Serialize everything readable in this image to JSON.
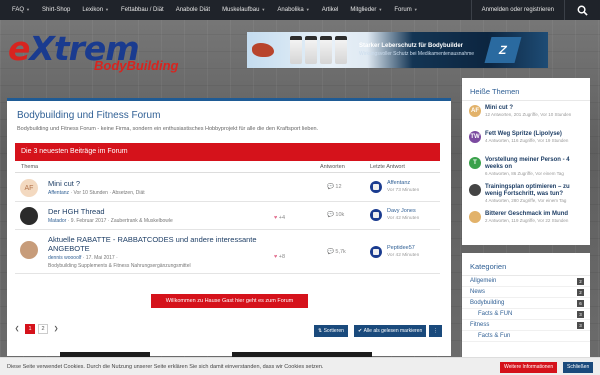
{
  "nav": {
    "items": [
      "FAQ",
      "Shirt-Shop",
      "Lexikon",
      "Fettabbau / Diät",
      "Anabole Diät",
      "Muskelaufbau",
      "Anabolika",
      "Artikel",
      "Mitglieder",
      "Forum"
    ],
    "login": "Anmelden oder registrieren"
  },
  "logo": {
    "ext_e": "e",
    "ext_rest": "Xtrem",
    "sub": "BodyBuilding"
  },
  "banner": {
    "line1": "Starker Leberschutz für Bodybuilder",
    "line2": "Wirkungsvoller Schutz bei Medikamentenausnahme"
  },
  "main": {
    "title": "Bodybuilding und Fitness Forum",
    "desc": "Bodybuilding und Fitness Forum - keine Firma, sondern ein enthusiastisches Hobbyprojekt für alle die den Kraftsport lieben.",
    "latest": "Die 3 neuesten Beiträge im Forum",
    "col_thema": "Thema",
    "col_antworten": "Antworten",
    "col_letzte": "Letzte Antwort",
    "rows": [
      {
        "avatar": "AF",
        "title": "Mini cut ?",
        "user": "Affentanz",
        "meta": "· Vor 10 Stunden · Absetzen, Diät",
        "likes": "",
        "replies": "12",
        "last_user": "Affentanz",
        "last_time": "Vor 73 Minuten"
      },
      {
        "avatar": "",
        "title": "Der HGH Thread",
        "user": "Matador",
        "meta": "· 9. Februar 2017 · Zaubertrank & Muskelbowle",
        "likes": "+4",
        "replies": "10k",
        "last_user": "Davy Jones",
        "last_time": "Vor 42 Minuten"
      },
      {
        "avatar": "",
        "title": "Aktuelle RABATTE - RABBATCODES und andere interessante ANGEBOTE",
        "user": "dennis woooolf",
        "meta": "· 17. Mai 2017 ·",
        "meta2": "Bodybuilding Supplements & Fitness Nahrungsergänzungsmittel",
        "likes": "+8",
        "replies": "5,7k",
        "last_user": "Peptidee57",
        "last_time": "Vor 42 Minuten"
      }
    ],
    "welcome": "Willkommen zu Hause Gast hier geht es zum Forum",
    "pager": [
      "1",
      "2"
    ],
    "sort": "Sortieren",
    "mark_read": "Alle als gelesen markieren"
  },
  "sidebar": {
    "themes_title": "Heiße Themen",
    "themes": [
      {
        "title": "Mini cut ?",
        "meta": "12 Antworten, 201 Zugriffe, Vor 10 Stunden",
        "icon": "AF",
        "color": "#e2b26a"
      },
      {
        "title": "Fett Weg Spritze (Lipolyse)",
        "meta": "4 Antworten, 116 Zugriffe, Vor 19 Stunden",
        "icon": "TW",
        "color": "#7b4aa0"
      },
      {
        "title": "Vorstellung meiner Person - 4 weeks on",
        "meta": "6 Antworten, 86 Zugriffe, Vor einem Tag",
        "icon": "T",
        "color": "#3aa14b"
      },
      {
        "title": "Trainingsplan optimieren – zu wenig Fortschritt, was tun?",
        "meta": "4 Antworten, 280 Zugriffe, Vor einem Tag",
        "icon": "",
        "color": "#444"
      },
      {
        "title": "Bitterer Geschmack im Mund",
        "meta": "2 Antworten, 119 Zugriffe, Vor 22 Stunden",
        "icon": "",
        "color": "#e2b26a"
      }
    ],
    "cats_title": "Kategorien",
    "cats": [
      {
        "label": "Allgemein",
        "count": "2",
        "sub": false
      },
      {
        "label": "News",
        "count": "2",
        "sub": false
      },
      {
        "label": "Bodybuilding",
        "count": "6",
        "sub": false
      },
      {
        "label": "Facts & FUN",
        "count": "3",
        "sub": true
      },
      {
        "label": "Fitness",
        "count": "3",
        "sub": false
      },
      {
        "label": "Facts & Fun",
        "count": "",
        "sub": true
      }
    ]
  },
  "cookie": {
    "text": "Diese Seite verwendet Cookies. Durch die Nutzung unserer Seite erklären Sie sich damit einverstanden, dass wir Cookies setzen.",
    "more": "Weitere Informationen",
    "close": "Schließen"
  }
}
